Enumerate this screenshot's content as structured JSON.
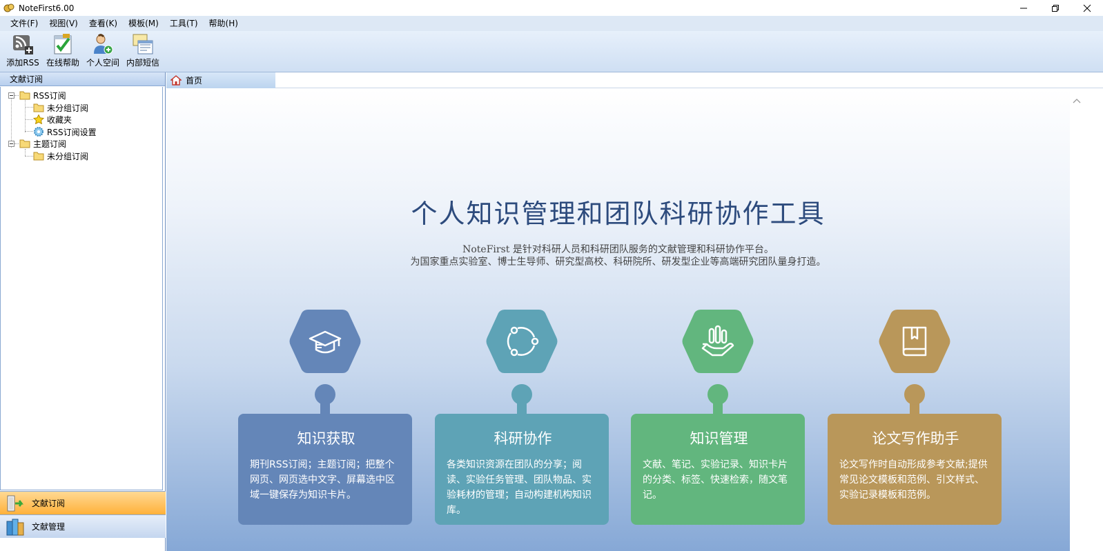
{
  "window": {
    "title": "NoteFirst6.00",
    "controls": [
      "minimize-icon",
      "restore-icon",
      "close-icon"
    ]
  },
  "menu": [
    "文件(F)",
    "视图(V)",
    "查看(K)",
    "模板(M)",
    "工具(T)",
    "帮助(H)"
  ],
  "toolbar": [
    {
      "label": "添加RSS",
      "icon": "rss-add-icon"
    },
    {
      "label": "在线帮助",
      "icon": "online-help-icon"
    },
    {
      "label": "个人空间",
      "icon": "personal-space-icon"
    },
    {
      "label": "内部短信",
      "icon": "internal-message-icon"
    }
  ],
  "left_panel": {
    "header": "文献订阅",
    "tree": [
      {
        "label": "RSS订阅",
        "icon": "folder-icon",
        "level": 0
      },
      {
        "label": "未分组订阅",
        "icon": "folder-icon",
        "level": 1
      },
      {
        "label": "收藏夹",
        "icon": "star-icon",
        "level": 1
      },
      {
        "label": "RSS订阅设置",
        "icon": "gear-icon",
        "level": 1
      },
      {
        "label": "主题订阅",
        "icon": "folder-icon",
        "level": 0
      },
      {
        "label": "未分组订阅",
        "icon": "folder-icon",
        "level": 1
      }
    ],
    "nav": [
      {
        "label": "文献订阅",
        "active": true
      },
      {
        "label": "文献管理",
        "active": false
      }
    ]
  },
  "tabs": [
    {
      "label": "首页",
      "icon": "home-icon"
    }
  ],
  "home": {
    "title": "个人知识管理和团队科研协作工具",
    "subtitle_brand": "NoteFirst",
    "subtitle_line1": "是针对科研人员和科研团队服务的文献管理和科研协作平台。",
    "subtitle_line2": "为国家重点实验室、博士生导师、研究型高校、科研院所、研发型企业等高端研究团队量身打造。",
    "features": [
      {
        "title": "知识获取",
        "desc": "期刊RSS订阅；主题订阅；把整个网页、网页选中文字、屏幕选中区域一键保存为知识卡片。",
        "color": "#6486b8",
        "icon": "graduation-cap-icon"
      },
      {
        "title": "科研协作",
        "desc": "各类知识资源在团队的分享；阅读、实验任务管理、团队物品、实验耗材的管理；自动构建机构知识库。",
        "color": "#5ea3b6",
        "icon": "collaboration-cycle-icon"
      },
      {
        "title": "知识管理",
        "desc": "文献、笔记、实验记录、知识卡片的分类、标签、快速检索，随文笔记。",
        "color": "#62b67e",
        "icon": "hand-chart-icon"
      },
      {
        "title": "论文写作助手",
        "desc": "论文写作时自动形成参考文献;提供常见论文模板和范例、引文样式、实验记录模板和范例。",
        "color": "#b9975a",
        "icon": "book-icon"
      }
    ]
  }
}
